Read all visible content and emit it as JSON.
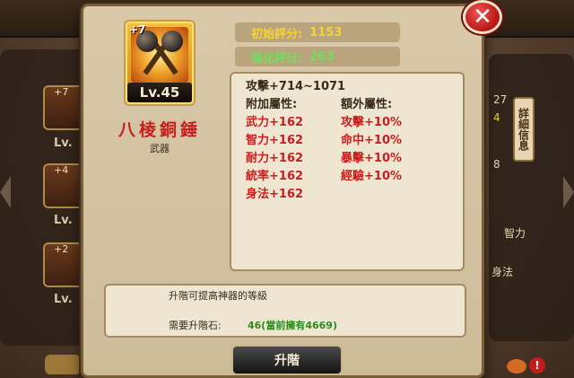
{
  "background": {
    "left_slots": [
      {
        "plus": "+7",
        "label": "Lv."
      },
      {
        "plus": "+4",
        "label": "Lv."
      },
      {
        "plus": "+2",
        "label": "Lv."
      }
    ],
    "detail_button": "詳細信息",
    "right_numbers": [
      "27",
      "4",
      "8"
    ],
    "right_labels": [
      "智力",
      "身法"
    ]
  },
  "item": {
    "plus_level": "+7",
    "level": "Lv.45",
    "name": "八棱銅錘",
    "type": "武器"
  },
  "scores": {
    "base_label": "初始評分:",
    "base_value": "1153",
    "enh_label": "強化評分:",
    "enh_value": "263"
  },
  "attributes": {
    "attack": "攻擊+714~1071",
    "extra_heading": "附加屬性:",
    "bonus_heading": "額外屬性:",
    "extra": [
      "武力+162",
      "智力+162",
      "耐力+162",
      "統率+162",
      "身法+162"
    ],
    "bonus": [
      "攻擊+10%",
      "命中+10%",
      "暴擊+10%",
      "經驗+10%"
    ]
  },
  "info": {
    "description": "升階可提高神器的等級",
    "requirement_label": "需要升階石:",
    "requirement_value": "46(當前擁有4669)"
  },
  "buttons": {
    "upgrade": "升階",
    "close": "✕"
  },
  "colors": {
    "item_name": "#c81e1e",
    "base_score": "#f7d233",
    "enh_score": "#6fe05a",
    "attribute_red": "#c81e1e",
    "requirement_green": "#2e8a1e"
  }
}
